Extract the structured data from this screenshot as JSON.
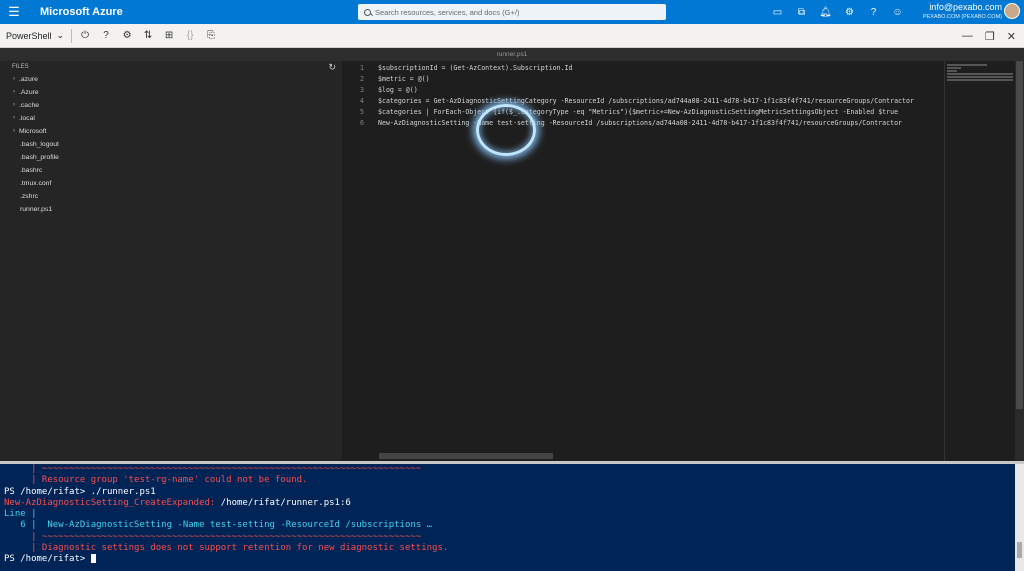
{
  "topbar": {
    "brand": "Microsoft Azure",
    "search_placeholder": "Search resources, services, and docs (G+/)",
    "account_email": "info@pexabo.com",
    "account_directory": "PEXABO.COM (PEXABO.COM)",
    "icons": [
      "cloud-shell-icon",
      "directory-filter-icon",
      "bell-icon",
      "gear-icon",
      "help-icon",
      "feedback-icon"
    ]
  },
  "toolbar": {
    "shell": "PowerShell",
    "icons": [
      "power-icon",
      "help-icon",
      "gear-icon",
      "upload-download-icon",
      "new-session-icon",
      "braces-icon",
      "web-preview-icon"
    ]
  },
  "editor": {
    "tab_title": "runner.ps1",
    "lines": [
      {
        "n": "1",
        "text": "$subscriptionId = (Get-AzContext).Subscription.Id"
      },
      {
        "n": "2",
        "text": "$metric = @()"
      },
      {
        "n": "3",
        "text": "$log = @()"
      },
      {
        "n": "4",
        "text": "$categories = Get-AzDiagnosticSettingCategory -ResourceId /subscriptions/ad744a08-2411-4d78-b417-1f1c83f4f741/resourceGroups/Contractor"
      },
      {
        "n": "5",
        "text": "$categories | ForEach-Object {if($_.CategoryType -eq \"Metrics\"){$metric+=New-AzDiagnosticSettingMetricSettingsObject -Enabled $true"
      },
      {
        "n": "6",
        "text": "New-AzDiagnosticSetting -Name test-setting -ResourceId /subscriptions/ad744a08-2411-4d78-b417-1f1c83f4f741/resourceGroups/Contractor"
      }
    ]
  },
  "explorer": {
    "header": "FILES",
    "folders": [
      ".azure",
      ".Azure",
      ".cache",
      ".local",
      "Microsoft"
    ],
    "files": [
      ".bash_logout",
      ".bash_profile",
      ".bashrc",
      ".tmux.conf",
      ".zshrc",
      "runner.ps1"
    ]
  },
  "terminal": {
    "l1": "     | ~~~~~~~~~~~~~~~~~~~~~~~~~~~~~~~~~~~~~~~~~~~~~~~~~~~~~~~~~~~~~~~~~~~~~~",
    "l2": "     | Resource group 'test-rg-name' could not be found.",
    "l3_prompt": "PS /home/rifat> ",
    "l3_cmd": "./runner.ps1",
    "l4_err": "New-AzDiagnosticSetting_CreateExpanded: ",
    "l4_path": "/home/rifat/runner.ps1:6",
    "l5": "Line |",
    "l6_num": "   6 |  ",
    "l6_code": "New-AzDiagnosticSetting -Name test-setting -ResourceId /subscriptions …",
    "l7": "     | ~~~~~~~~~~~~~~~~~~~~~~~~~~~~~~~~~~~~~~~~~~~~~~~~~~~~~~~~~~~~~~~~~~~~~~",
    "l8": "     | Diagnostic settings does not support retention for new diagnostic settings.",
    "l9_prompt": "PS /home/rifat> "
  }
}
